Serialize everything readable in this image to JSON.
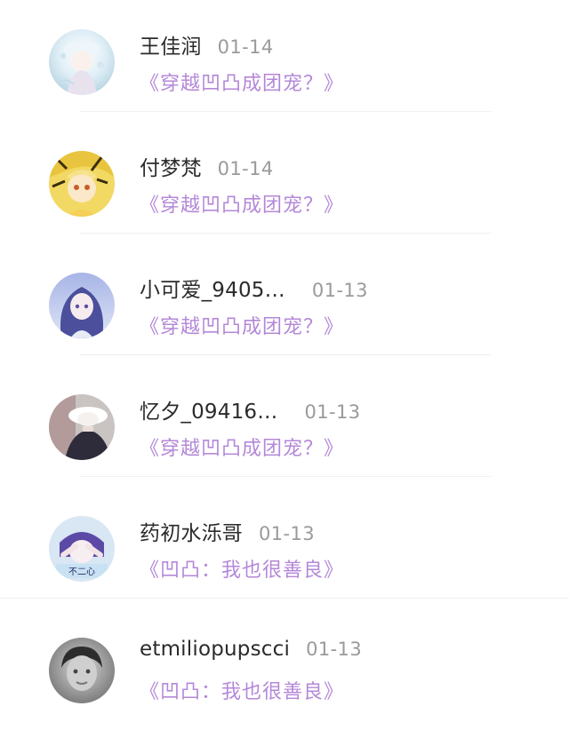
{
  "comments": [
    {
      "name": "王佳润",
      "date": "01-14",
      "work": "《穿越凹凸成团宠？》",
      "avatar": "anime-girl-white-avatar"
    },
    {
      "name": "付梦梵",
      "date": "01-14",
      "work": "《穿越凹凸成团宠？》",
      "avatar": "anime-yellow-avatar"
    },
    {
      "name": "小可爱_9405…",
      "date": "01-13",
      "work": "《穿越凹凸成团宠？》",
      "avatar": "anime-girl-purple-avatar"
    },
    {
      "name": "忆夕_09416…",
      "date": "01-13",
      "work": "《穿越凹凸成团宠？》",
      "avatar": "photo-hat-avatar"
    },
    {
      "name": "药初水泺哥",
      "date": "01-13",
      "work": "《凹凸：我也很善良》",
      "avatar": "anime-boy-blue-avatar"
    },
    {
      "name": "etmiliopupscci",
      "date": "01-13",
      "work": "《凹凸：我也很善良》",
      "avatar": "boy-photo-grayscale-avatar"
    }
  ],
  "colors": {
    "name": "#2b2b2b",
    "date": "#9a9a9a",
    "work_link": "#b488d8",
    "divider": "#f0f0f0"
  }
}
